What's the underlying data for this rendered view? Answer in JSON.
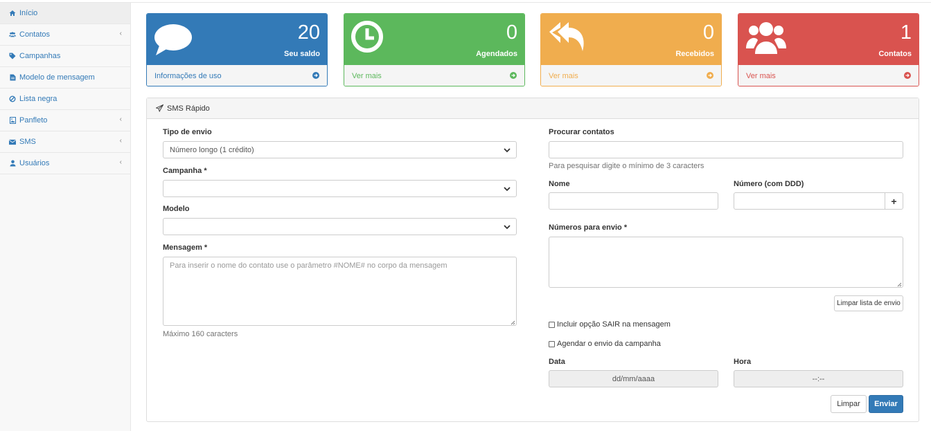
{
  "sidebar": {
    "items": [
      {
        "label": "Início",
        "icon": "home-icon",
        "has_submenu": false
      },
      {
        "label": "Contatos",
        "icon": "users-icon",
        "has_submenu": true
      },
      {
        "label": "Campanhas",
        "icon": "tag-icon",
        "has_submenu": false
      },
      {
        "label": "Modelo de mensagem",
        "icon": "file-icon",
        "has_submenu": false
      },
      {
        "label": "Lista negra",
        "icon": "ban-icon",
        "has_submenu": false
      },
      {
        "label": "Panfleto",
        "icon": "image-icon",
        "has_submenu": true
      },
      {
        "label": "SMS",
        "icon": "envelope-icon",
        "has_submenu": true
      },
      {
        "label": "Usuários",
        "icon": "user-icon",
        "has_submenu": true
      }
    ],
    "chevron": "‹"
  },
  "cards": [
    {
      "value": "20",
      "label": "Seu saldo",
      "link": "Informações de uso",
      "color": "#337ab7",
      "icon": "comment-icon"
    },
    {
      "value": "0",
      "label": "Agendados",
      "link": "Ver mais",
      "color": "#5cb85c",
      "icon": "clock-icon"
    },
    {
      "value": "0",
      "label": "Recebidos",
      "link": "Ver mais",
      "color": "#f0ad4e",
      "icon": "reply-all-icon"
    },
    {
      "value": "1",
      "label": "Contatos",
      "link": "Ver mais",
      "color": "#d9534f",
      "icon": "group-icon"
    }
  ],
  "panel": {
    "title": "SMS Rápido",
    "left": {
      "tipo_label": "Tipo de envio",
      "tipo_value": "Número longo (1 crédito)",
      "campanha_label": "Campanha",
      "campanha_value": "",
      "modelo_label": "Modelo",
      "modelo_value": "",
      "mensagem_label": "Mensagem",
      "mensagem_placeholder": "Para inserir o nome do contato use o parâmetro #NOME# no corpo da mensagem",
      "mensagem_help": "Máximo 160 caracters",
      "required_mark": "*"
    },
    "right": {
      "procurar_label": "Procurar contatos",
      "procurar_value": "",
      "procurar_help": "Para pesquisar digite o mínimo de 3 caracters",
      "nome_label": "Nome",
      "numero_label": "Número (com DDD)",
      "add_button": "+",
      "numeros_label": "Números para envio",
      "limpar_lista_button": "Limpar lista de envio",
      "incluir_sair_label": "Incluir opção SAIR na mensagem",
      "agendar_label": "Agendar o envio da campanha",
      "data_label": "Data",
      "data_value": "dd/mm/aaaa",
      "hora_label": "Hora",
      "hora_value": "--:--",
      "limpar_button": "Limpar",
      "enviar_button": "Enviar"
    }
  }
}
